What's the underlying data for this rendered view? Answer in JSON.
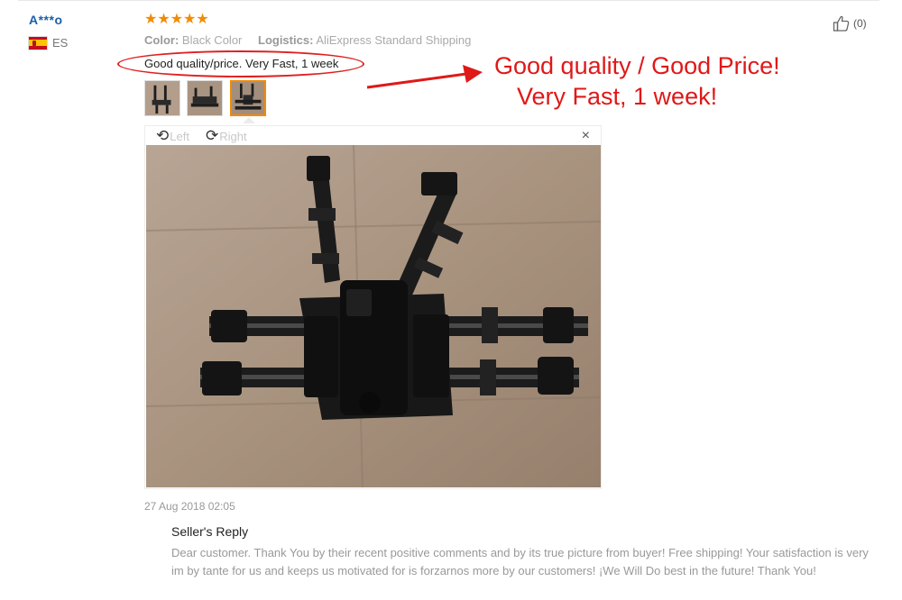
{
  "review": {
    "user": "A***o",
    "country": "ES",
    "rating": 5,
    "color_key": "Color:",
    "color_value": "Black Color",
    "logistics_key": "Logistics:",
    "logistics_value": "AliExpress Standard Shipping",
    "text": "Good quality/price. Very Fast, 1 week",
    "likes": "(0)",
    "date": "27 Aug 2018 02:05"
  },
  "annotation": {
    "line1": "Good quality / Good Price!",
    "line2": "Very Fast, 1 week!",
    "color": "#e01818"
  },
  "viewer": {
    "rotate_left": "Left",
    "rotate_right": "Right",
    "close": "×"
  },
  "seller_reply": {
    "title": "Seller's Reply",
    "text": "Dear customer. Thank You by their recent positive comments and by its true picture from buyer! Free shipping! Your satisfaction is very im by tante for us and keeps us motivated for is forzarnos more by our customers! ¡We Will Do best in the future! Thank You!"
  },
  "icons": {
    "star": "star-icon",
    "like": "thumbs-up-icon",
    "rotate_left": "rotate-left-icon",
    "rotate_right": "rotate-right-icon",
    "close": "close-icon",
    "flag": "spain-flag-icon"
  },
  "colors": {
    "star": "#f28b00",
    "username": "#1a5fa8",
    "selected_thumb": "#f28b00"
  }
}
